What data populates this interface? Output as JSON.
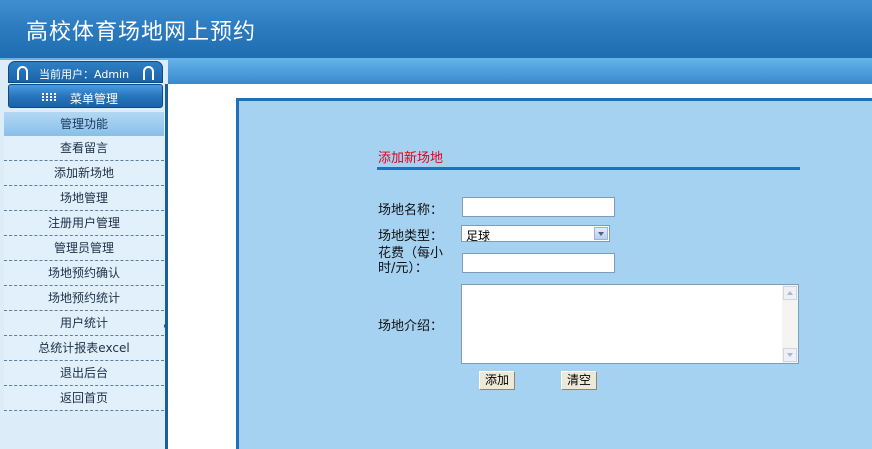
{
  "header": {
    "title": "高校体育场地网上预约"
  },
  "user": {
    "label": "当前用户：Admin"
  },
  "menu": {
    "header_label": "菜单管理",
    "section_title": "管理功能",
    "items": [
      {
        "label": "查看留言"
      },
      {
        "label": "添加新场地"
      },
      {
        "label": "场地管理"
      },
      {
        "label": "注册用户管理"
      },
      {
        "label": "管理员管理"
      },
      {
        "label": "场地预约确认"
      },
      {
        "label": "场地预约统计"
      },
      {
        "label": "用户统计"
      },
      {
        "label": "总统计报表excel"
      },
      {
        "label": "退出后台"
      },
      {
        "label": "返回首页"
      }
    ]
  },
  "form": {
    "title": "添加新场地",
    "name_label": "场地名称：",
    "name_value": "",
    "type_label": "场地类型：",
    "type_value": "足球",
    "cost_label": "花费（每小时/元）：",
    "cost_value": "",
    "intro_label": "场地介绍：",
    "intro_value": "",
    "add_button": "添加",
    "clear_button": "清空"
  },
  "colors": {
    "header_blue": "#2d7cc1",
    "content_bg": "#a6d2f1",
    "title_red": "#e0001a",
    "sidebar_bg": "#dcecf9"
  },
  "icons": [
    "binder-ring-icon",
    "menu-grid-icon",
    "dropdown-arrow-icon"
  ]
}
